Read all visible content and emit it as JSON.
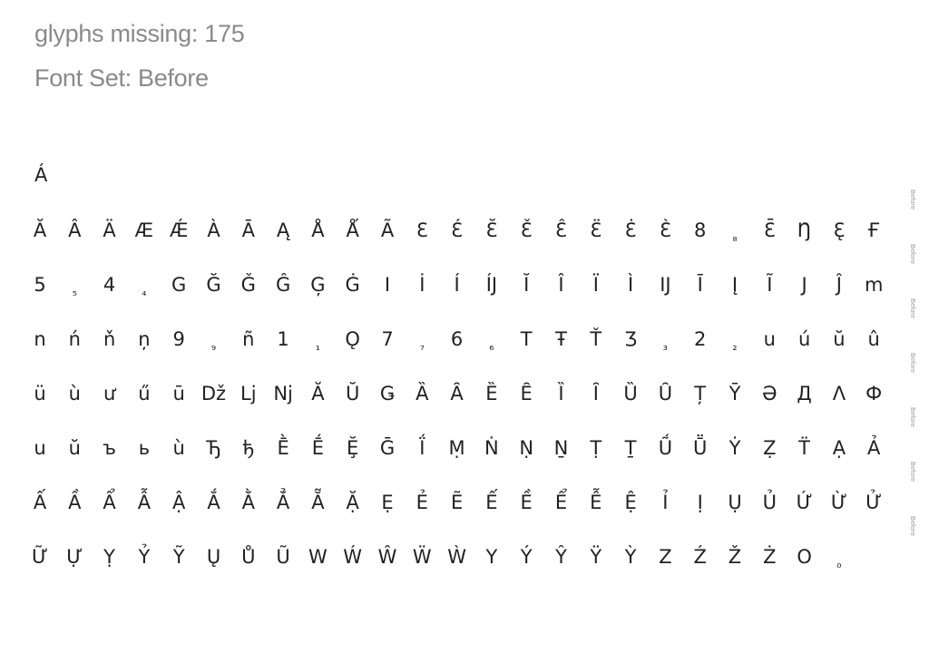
{
  "header": {
    "title": "glyphs missing: 175",
    "subtitle": "Font Set: Before"
  },
  "first_glyph": "Á",
  "rows": [
    [
      "Ă",
      "Â",
      "Ä",
      "Æ",
      "Ǽ",
      "À",
      "Ā",
      "Ą",
      "Å",
      "Ǻ",
      "Ã",
      "Ɛ",
      "Ɛ́",
      "Ɛ̆",
      "Ɛ̌",
      "Ɛ̂",
      "Ɛ̈",
      "Ɛ̇",
      "Ɛ̀",
      "8",
      "₈",
      "Ɛ̄",
      "Ŋ",
      "Ɛ̨",
      "Ғ"
    ],
    [
      "5",
      "₅",
      "4",
      "₄",
      "G",
      "Ğ",
      "Ǧ",
      "Ĝ",
      "Ģ",
      "Ġ",
      "I",
      "İ",
      "Í",
      "ÍJ",
      "Ĭ",
      "Î",
      "Ï",
      "Ì",
      "IJ",
      "Ī",
      "Į",
      "Ĩ",
      "J",
      "Ĵ",
      "m"
    ],
    [
      "n",
      "ń",
      "ň",
      "ņ",
      "9",
      "₉",
      "ñ",
      "1",
      "₁",
      "Ǫ",
      "7",
      "₇",
      "6",
      "₆",
      "T",
      "Ŧ",
      "Ť",
      "Ʒ",
      "₃",
      "2",
      "₂",
      "u",
      "ú",
      "ŭ",
      "û"
    ],
    [
      "ü",
      "ù",
      "ư",
      "ű",
      "ū",
      "Dž",
      "Lj",
      "Nj",
      "Ă",
      "Ŭ",
      "Ǥ",
      "Ȁ",
      "Ȃ",
      "Ȅ",
      "Ȇ",
      "Ȉ",
      "Ȋ",
      "Ȕ",
      "Ȗ",
      "Ț",
      "Ȳ",
      "Ə",
      "Д",
      "Λ",
      "Ф"
    ],
    [
      "u",
      "ŭ",
      "ъ",
      "ь",
      "ù",
      "Ђ",
      "ђ",
      "Ḕ",
      "Ḗ",
      "Ḝ",
      "Ḡ",
      "Ḯ",
      "Ṃ",
      "Ṅ",
      "Ṇ",
      "Ṉ",
      "Ṭ",
      "Ṯ",
      "Ṹ",
      "Ṻ",
      "Ẏ",
      "Ẓ",
      "T̈",
      "Ạ",
      "Ả"
    ],
    [
      "Ấ",
      "Ầ",
      "Ẩ",
      "Ẫ",
      "Ậ",
      "Ắ",
      "Ằ",
      "Ẳ",
      "Ẵ",
      "Ặ",
      "Ẹ",
      "Ẻ",
      "Ẽ",
      "Ế",
      "Ề",
      "Ể",
      "Ễ",
      "Ệ",
      "Ỉ",
      "Ị",
      "Ụ",
      "Ủ",
      "Ứ",
      "Ừ",
      "Ử"
    ],
    [
      "Ữ",
      "Ự",
      "Ỵ",
      "Ỷ",
      "Ỹ",
      "Ų",
      "Ů",
      "Ũ",
      "W",
      "Ẃ",
      "Ŵ",
      "Ẅ",
      "Ẁ",
      "Y",
      "Ý",
      "Ŷ",
      "Ÿ",
      "Ỳ",
      "Z",
      "Ź",
      "Ž",
      "Ż",
      "O",
      "₀"
    ]
  ],
  "font_set_label": "Before"
}
